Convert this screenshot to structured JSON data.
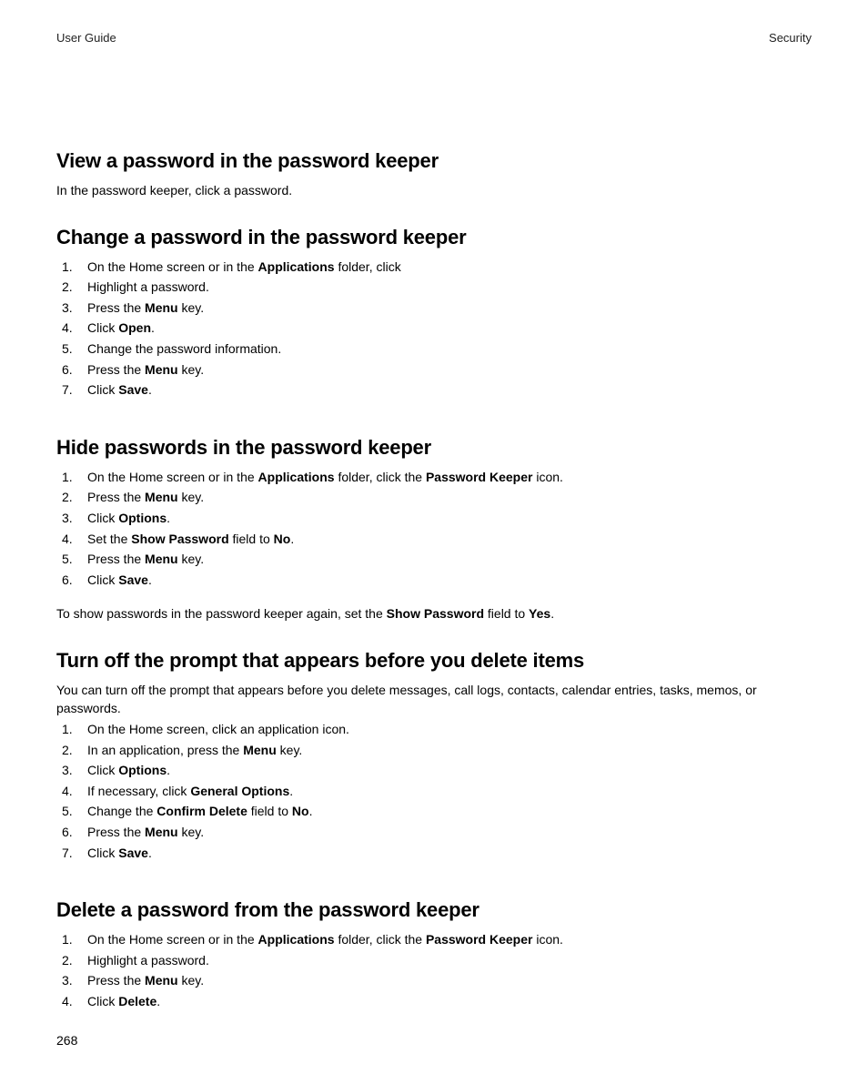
{
  "header": {
    "left": "User Guide",
    "right": "Security"
  },
  "pageNumber": "268",
  "sections": [
    {
      "heading": "View a password in the password keeper",
      "body": [
        "In the password keeper, click a password."
      ]
    },
    {
      "heading": "Change a password in the password keeper",
      "list": [
        [
          {
            "t": "On the Home screen or in the "
          },
          {
            "t": "Applications",
            "b": true
          },
          {
            "t": " folder, click"
          }
        ],
        [
          {
            "t": "Highlight a password."
          }
        ],
        [
          {
            "t": "Press the "
          },
          {
            "t": "Menu",
            "b": true
          },
          {
            "t": " key."
          }
        ],
        [
          {
            "t": "Click "
          },
          {
            "t": "Open",
            "b": true
          },
          {
            "t": "."
          }
        ],
        [
          {
            "t": "Change the password information."
          }
        ],
        [
          {
            "t": "Press the "
          },
          {
            "t": "Menu",
            "b": true
          },
          {
            "t": " key."
          }
        ],
        [
          {
            "t": "Click "
          },
          {
            "t": "Save",
            "b": true
          },
          {
            "t": "."
          }
        ]
      ]
    },
    {
      "heading": "Hide passwords in the password keeper",
      "list": [
        [
          {
            "t": "On the Home screen or in the "
          },
          {
            "t": "Applications",
            "b": true
          },
          {
            "t": " folder, click the "
          },
          {
            "t": "Password Keeper",
            "b": true
          },
          {
            "t": " icon."
          }
        ],
        [
          {
            "t": "Press the "
          },
          {
            "t": "Menu",
            "b": true
          },
          {
            "t": " key."
          }
        ],
        [
          {
            "t": "Click "
          },
          {
            "t": "Options",
            "b": true
          },
          {
            "t": "."
          }
        ],
        [
          {
            "t": "Set the "
          },
          {
            "t": "Show Password",
            "b": true
          },
          {
            "t": " field to "
          },
          {
            "t": "No",
            "b": true
          },
          {
            "t": "."
          }
        ],
        [
          {
            "t": "Press the "
          },
          {
            "t": "Menu",
            "b": true
          },
          {
            "t": " key."
          }
        ],
        [
          {
            "t": "Click "
          },
          {
            "t": "Save",
            "b": true
          },
          {
            "t": "."
          }
        ]
      ],
      "note": [
        {
          "t": "To show passwords in the password keeper again, set the "
        },
        {
          "t": "Show Password",
          "b": true
        },
        {
          "t": " field to "
        },
        {
          "t": "Yes",
          "b": true
        },
        {
          "t": "."
        }
      ]
    },
    {
      "heading": "Turn off the prompt that appears before you delete items",
      "intro": [
        {
          "t": "You can turn off the prompt that appears before you delete messages, call logs, contacts, calendar entries, tasks, memos, or passwords."
        }
      ],
      "list": [
        [
          {
            "t": "On the Home screen, click an application icon."
          }
        ],
        [
          {
            "t": "In an application, press the "
          },
          {
            "t": "Menu",
            "b": true
          },
          {
            "t": " key."
          }
        ],
        [
          {
            "t": "Click "
          },
          {
            "t": "Options",
            "b": true
          },
          {
            "t": "."
          }
        ],
        [
          {
            "t": "If necessary, click "
          },
          {
            "t": "General Options",
            "b": true
          },
          {
            "t": "."
          }
        ],
        [
          {
            "t": "Change the "
          },
          {
            "t": "Confirm Delete",
            "b": true
          },
          {
            "t": " field to "
          },
          {
            "t": "No",
            "b": true
          },
          {
            "t": "."
          }
        ],
        [
          {
            "t": "Press the "
          },
          {
            "t": "Menu",
            "b": true
          },
          {
            "t": " key."
          }
        ],
        [
          {
            "t": "Click "
          },
          {
            "t": "Save",
            "b": true
          },
          {
            "t": "."
          }
        ]
      ]
    },
    {
      "heading": "Delete a password from the password keeper",
      "list": [
        [
          {
            "t": "On the Home screen or in the "
          },
          {
            "t": "Applications",
            "b": true
          },
          {
            "t": " folder, click the "
          },
          {
            "t": "Password Keeper",
            "b": true
          },
          {
            "t": " icon."
          }
        ],
        [
          {
            "t": "Highlight a password."
          }
        ],
        [
          {
            "t": "Press the "
          },
          {
            "t": "Menu",
            "b": true
          },
          {
            "t": " key."
          }
        ],
        [
          {
            "t": "Click "
          },
          {
            "t": "Delete",
            "b": true
          },
          {
            "t": "."
          }
        ]
      ]
    }
  ]
}
